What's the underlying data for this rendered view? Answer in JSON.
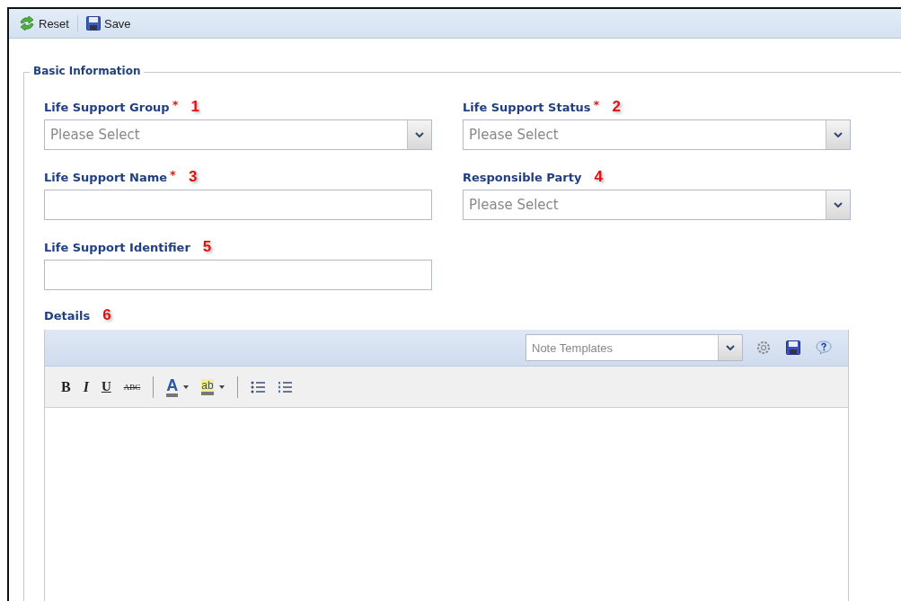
{
  "toolbar": [
    {
      "kind": "reset",
      "label": "Reset"
    },
    {
      "kind": "save",
      "label": "Save"
    }
  ],
  "section": {
    "title": "Basic Information",
    "fields": [
      {
        "label": "Life Support Group",
        "required_mark": "*",
        "marker": "1",
        "kind": "select",
        "placeholder": "Please Select"
      },
      {
        "label": "Life Support Status",
        "required_mark": "*",
        "marker": "2",
        "kind": "select",
        "placeholder": "Please Select"
      },
      {
        "label": "Life Support Name",
        "required_mark": "*",
        "marker": "3",
        "kind": "text"
      },
      {
        "label": "Responsible Party",
        "marker": "4",
        "kind": "select",
        "placeholder": "Please Select"
      },
      {
        "label": "Life Support Identifier",
        "marker": "5",
        "kind": "text"
      }
    ],
    "details": {
      "label": "Details",
      "marker": "6",
      "template_select": {
        "placeholder": "Note Templates"
      },
      "format_groups": [
        [
          {
            "kind": "bold",
            "label": "B"
          },
          {
            "kind": "italic",
            "label": "I"
          },
          {
            "kind": "underline",
            "label": "U"
          },
          {
            "kind": "strike",
            "label": "ABC"
          }
        ],
        [
          {
            "kind": "font_color",
            "label": "A"
          },
          {
            "kind": "highlight",
            "label": "ab"
          }
        ],
        [
          {
            "kind": "bullets"
          },
          {
            "kind": "numbering"
          }
        ]
      ]
    }
  }
}
